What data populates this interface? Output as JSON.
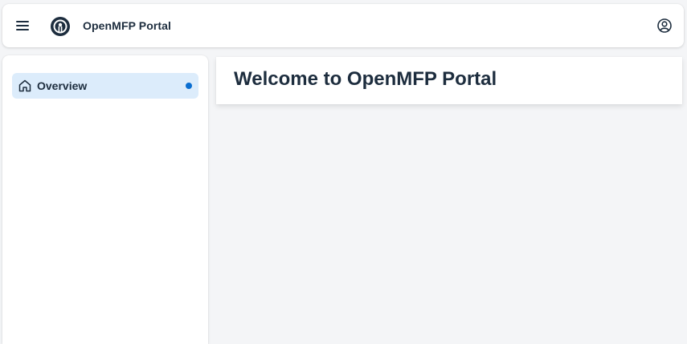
{
  "shellbar": {
    "menu_icon": "hamburger-menu-icon",
    "logo_icon": "openmfp-logo-icon",
    "title": "OpenMFP Portal",
    "profile_icon": "user-profile-icon"
  },
  "sidebar": {
    "items": [
      {
        "label": "Overview",
        "icon": "home-icon",
        "selected": true,
        "indicator_color": "#0a6ed1"
      }
    ]
  },
  "main": {
    "title": "Welcome to OpenMFP Portal"
  },
  "colors": {
    "selected_bg": "#dcecfb",
    "text": "#1d2d3e",
    "background": "#f4f5f7"
  }
}
